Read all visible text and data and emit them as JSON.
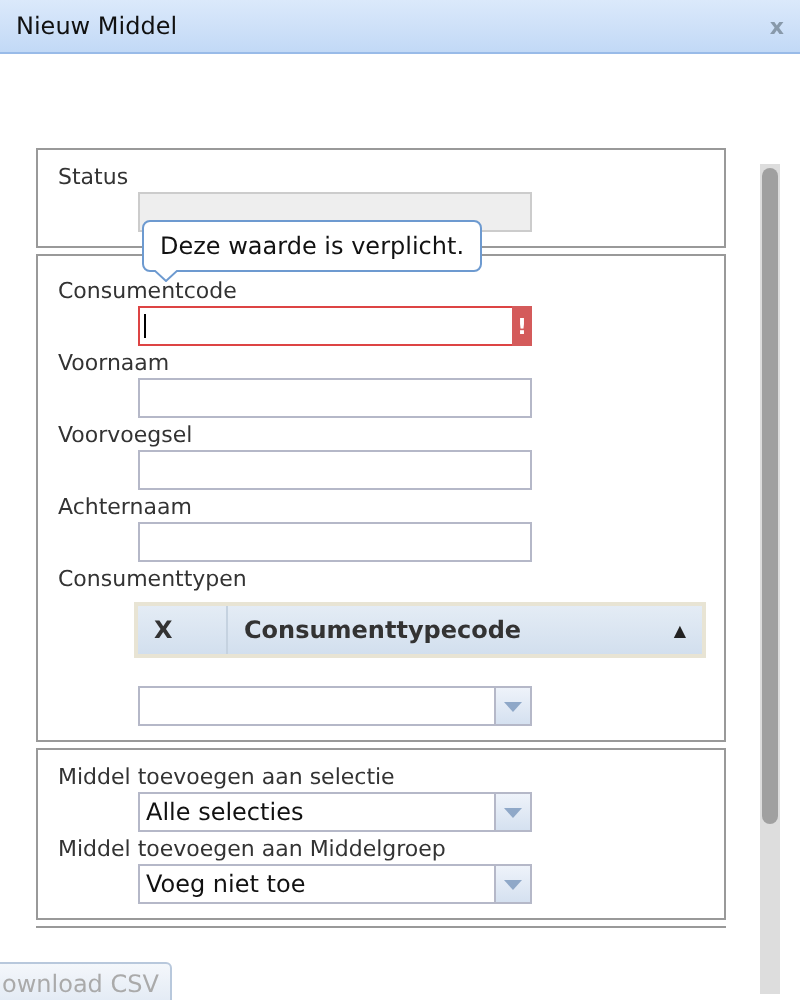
{
  "window": {
    "title": "Nieuw Middel",
    "close": "x"
  },
  "tooltip": {
    "text": "Deze waarde is verplicht."
  },
  "sections": [
    {
      "fields": [
        {
          "kind": "text",
          "label": "Status",
          "disabled": true,
          "invalid": false
        }
      ]
    },
    {
      "fields": [
        {
          "kind": "text",
          "label": "Consumentcode",
          "disabled": false,
          "invalid": true,
          "error_mark": "!"
        },
        {
          "kind": "text",
          "label": "Voornaam",
          "disabled": false,
          "invalid": false
        },
        {
          "kind": "text",
          "label": "Voorvoegsel",
          "disabled": false,
          "invalid": false
        },
        {
          "kind": "text",
          "label": "Achternaam",
          "disabled": false,
          "invalid": false
        },
        {
          "kind": "grid",
          "label": "Consumenttypen",
          "columns": [
            "X",
            "Consumenttypecode"
          ],
          "sort_mark": "▲"
        },
        {
          "kind": "combo"
        }
      ]
    },
    {
      "fields": [
        {
          "kind": "combo",
          "label": "Middel toevoegen aan selectie",
          "value": "Alle selecties"
        },
        {
          "kind": "combo",
          "label": "Middel toevoegen aan Middelgroep",
          "value": "Voeg niet toe"
        }
      ]
    }
  ],
  "download_button": {
    "label": "ownload CSV",
    "disabled": true
  }
}
